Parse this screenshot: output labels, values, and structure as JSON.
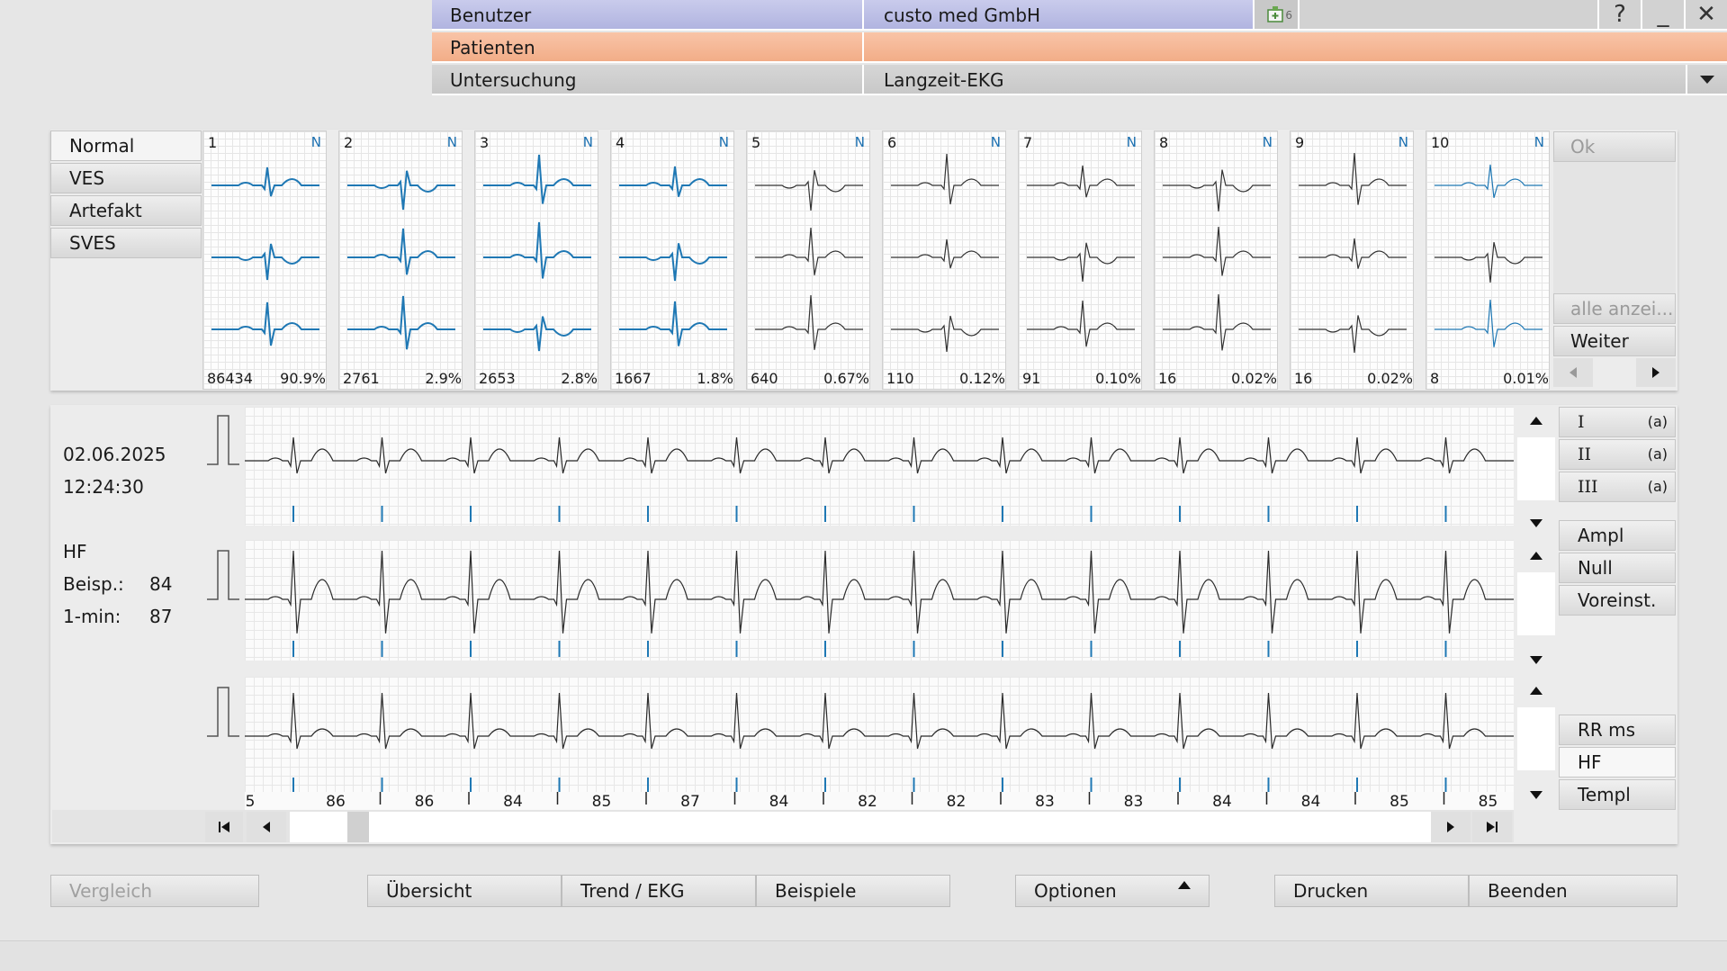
{
  "header": {
    "user_label": "Benutzer",
    "user_value": "custo med GmbH",
    "badge_count": "6",
    "patient_label": "Patienten",
    "patient_value": "",
    "exam_label": "Untersuchung",
    "exam_value": "Langzeit-EKG",
    "help": "?",
    "minimize": "_",
    "close": "✕"
  },
  "categories": [
    "Normal",
    "VES",
    "Artefakt",
    "SVES"
  ],
  "templates": [
    {
      "num": "1",
      "cls": "N",
      "count": "86434",
      "pct": "90.9%"
    },
    {
      "num": "2",
      "cls": "N",
      "count": "2761",
      "pct": "2.9%"
    },
    {
      "num": "3",
      "cls": "N",
      "count": "2653",
      "pct": "2.8%"
    },
    {
      "num": "4",
      "cls": "N",
      "count": "1667",
      "pct": "1.8%"
    },
    {
      "num": "5",
      "cls": "N",
      "count": "640",
      "pct": "0.67%"
    },
    {
      "num": "6",
      "cls": "N",
      "count": "110",
      "pct": "0.12%"
    },
    {
      "num": "7",
      "cls": "N",
      "count": "91",
      "pct": "0.10%"
    },
    {
      "num": "8",
      "cls": "N",
      "count": "16",
      "pct": "0.02%"
    },
    {
      "num": "9",
      "cls": "N",
      "count": "16",
      "pct": "0.02%"
    },
    {
      "num": "10",
      "cls": "N",
      "count": "8",
      "pct": "0.01%"
    }
  ],
  "template_side": {
    "ok": "Ok",
    "show_all": "alle anzei...",
    "next": "Weiter"
  },
  "ekg": {
    "date": "02.06.2025",
    "time": "12:24:30",
    "hf_label": "HF",
    "beisp_label": "Beisp.:",
    "beisp_value": "84",
    "min_label": "1-min:",
    "min_value": "87",
    "heart_rates": [
      "5",
      "86",
      "86",
      "84",
      "85",
      "87",
      "84",
      "82",
      "82",
      "83",
      "83",
      "84",
      "84",
      "85",
      "85"
    ]
  },
  "channels": [
    {
      "name": "I",
      "suffix": "(a)"
    },
    {
      "name": "II",
      "suffix": "(a)"
    },
    {
      "name": "III",
      "suffix": "(a)"
    }
  ],
  "controls": {
    "ampl": "Ampl",
    "null": "Null",
    "preset": "Voreinst.",
    "rr": "RR ms",
    "hf": "HF",
    "templ": "Templ"
  },
  "bottom": {
    "compare": "Vergleich",
    "overview": "Übersicht",
    "trend": "Trend / EKG",
    "examples": "Beispiele",
    "options": "Optionen",
    "print": "Drucken",
    "quit": "Beenden"
  },
  "colors": {
    "user_bar": "#b8bbe4",
    "patient_bar": "#f4b592",
    "ecg_trace": "#2a2a2a",
    "template_blue": "#1f78b4"
  }
}
